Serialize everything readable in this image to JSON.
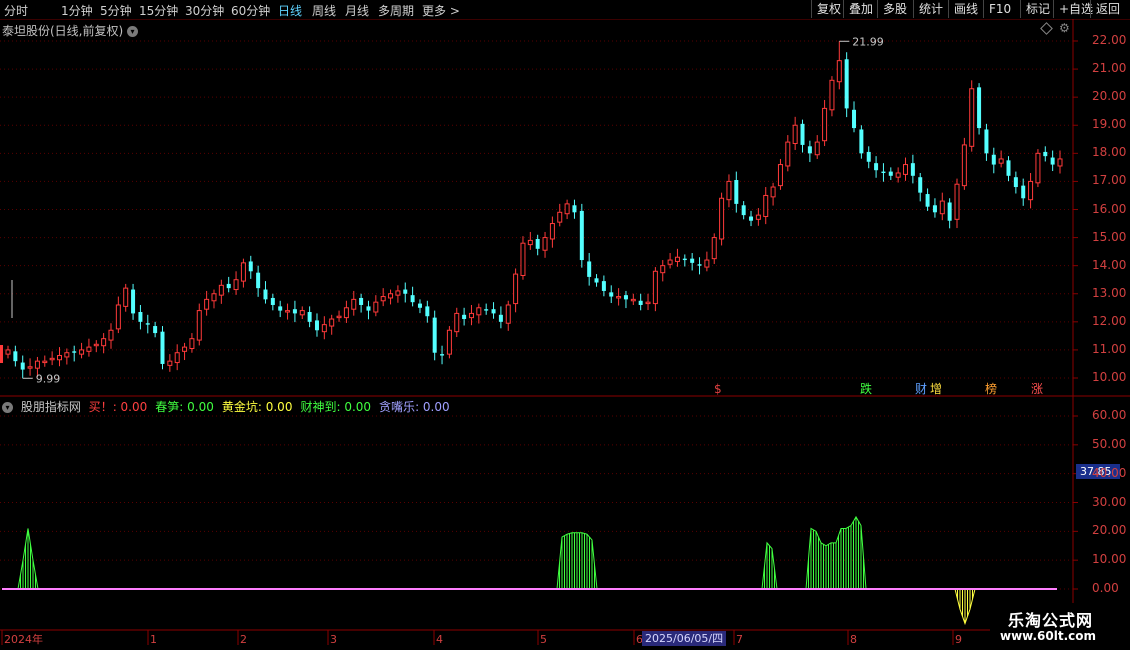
{
  "toolbar": {
    "periods": [
      "分时",
      "1分钟",
      "5分钟",
      "15分钟",
      "30分钟",
      "60分钟",
      "日线",
      "周线",
      "月线",
      "多周期",
      "更多 >"
    ],
    "active": "日线",
    "buttons": [
      "复权",
      "叠加",
      "多股",
      "统计",
      "画线",
      "F10",
      "标记",
      "+自选",
      "返回"
    ]
  },
  "stock": {
    "title": "泰坦股份(日线,前复权)"
  },
  "price_axis": {
    "labels": [
      "22.00",
      "21.00",
      "20.00",
      "19.00",
      "18.00",
      "17.00",
      "16.00",
      "15.00",
      "14.00",
      "13.00",
      "12.00",
      "11.00",
      "10.00"
    ]
  },
  "annotations": {
    "high": "21.99",
    "low": "9.99"
  },
  "event_marks": [
    {
      "text": "$",
      "color": "#e04040"
    },
    {
      "text": "跌",
      "color": "#40ff40"
    },
    {
      "text": "财",
      "color": "#5fa0ff"
    },
    {
      "text": "增",
      "color": "#ffdf40"
    },
    {
      "text": "榜",
      "color": "#ffa030"
    },
    {
      "text": "涨",
      "color": "#ff5050"
    }
  ],
  "indicator": {
    "name": "股朋指标网",
    "items": [
      {
        "label": "买！",
        "value": ": 0.00",
        "color": "#ff4040"
      },
      {
        "label": "春笋",
        "value": ": 0.00",
        "color": "#40ff40"
      },
      {
        "label": "黄金坑",
        "value": ": 0.00",
        "color": "#ffff40"
      },
      {
        "label": "财神到",
        "value": ": 0.00",
        "color": "#40ff40"
      },
      {
        "label": "贪嘴乐",
        "value": ": 0.00",
        "color": "#a0a0ff"
      }
    ],
    "axis_labels": [
      "60.00",
      "50.00",
      "40.00",
      "30.00",
      "20.00",
      "10.00",
      "0.00"
    ],
    "current_value": "37.85"
  },
  "time_axis": {
    "labels": [
      "2024年",
      "1",
      "2",
      "3",
      "4",
      "5",
      "6",
      "7",
      "8",
      "9"
    ],
    "current_date": "2025/06/05/四"
  },
  "watermark": {
    "main": "乐淘公式网",
    "sub": "www.60lt.com"
  },
  "chart_data": {
    "type": "candlestick",
    "ylim": [
      9.6,
      22.5
    ],
    "high": 21.99,
    "low": 9.99,
    "closes": [
      11.0,
      10.6,
      10.3,
      10.4,
      10.6,
      10.6,
      10.7,
      10.8,
      10.9,
      10.9,
      11.0,
      11.1,
      11.2,
      11.4,
      11.7,
      12.6,
      13.2,
      12.3,
      12.0,
      11.9,
      11.6,
      10.5,
      10.6,
      10.9,
      11.1,
      11.4,
      12.4,
      12.8,
      13.0,
      13.3,
      13.2,
      13.5,
      14.1,
      13.8,
      13.2,
      12.8,
      12.6,
      12.4,
      12.4,
      12.3,
      12.4,
      12.0,
      11.7,
      11.9,
      12.1,
      12.2,
      12.5,
      12.8,
      12.6,
      12.4,
      12.7,
      12.9,
      13.0,
      13.1,
      13.0,
      12.7,
      12.5,
      12.2,
      10.9,
      10.8,
      11.7,
      12.3,
      12.1,
      12.3,
      12.5,
      12.4,
      12.3,
      12.0,
      12.6,
      13.7,
      14.8,
      14.9,
      14.6,
      15.0,
      15.5,
      15.9,
      16.2,
      15.9,
      14.2,
      13.6,
      13.4,
      13.1,
      12.9,
      12.9,
      12.8,
      12.8,
      12.6,
      12.7,
      13.8,
      14.0,
      14.2,
      14.3,
      14.2,
      14.1,
      14.0,
      14.2,
      15.0,
      16.4,
      17.0,
      16.2,
      15.8,
      15.6,
      15.8,
      16.5,
      16.8,
      17.6,
      18.4,
      19.0,
      18.3,
      18.0,
      18.4,
      19.6,
      20.6,
      21.3,
      19.6,
      18.9,
      18.0,
      17.7,
      17.4,
      17.3,
      17.2,
      17.3,
      17.6,
      17.2,
      16.6,
      16.1,
      15.9,
      16.3,
      15.6,
      16.9,
      18.3,
      20.3,
      18.9,
      18.0,
      17.6,
      17.8,
      17.2,
      16.8,
      16.4,
      17.0,
      18.0,
      17.9,
      17.6,
      17.8
    ]
  },
  "indicator_data": {
    "ylim": [
      -10,
      67
    ],
    "segments": [
      {
        "color": "#40ff40",
        "values": [
          0,
          10,
          21,
          10,
          0
        ]
      },
      {
        "color": "#40ff40",
        "values": [
          0,
          18,
          19,
          19.5,
          19.5,
          19.5,
          19,
          17,
          0
        ]
      },
      {
        "color": "#40ff40",
        "values": [
          0,
          16,
          14,
          0
        ]
      },
      {
        "color": "#40ff40",
        "values": [
          0,
          21,
          20,
          16,
          15,
          16,
          16,
          21,
          21,
          22,
          25,
          22,
          0
        ]
      },
      {
        "color": "#ffff40",
        "values": [
          0,
          -7,
          -12,
          -7,
          0
        ]
      }
    ]
  }
}
